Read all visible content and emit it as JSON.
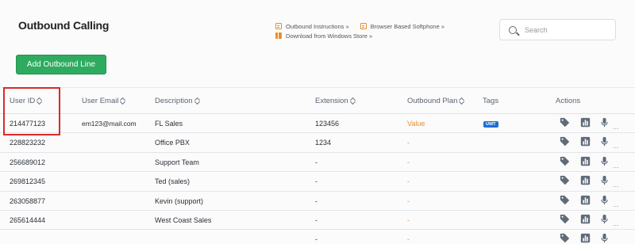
{
  "page": {
    "title": "Outbound Calling"
  },
  "links": {
    "outbound_instructions": "Outbound Instructions »",
    "browser_softphone": "Browser Based Softphone »",
    "windows_store": "Download from Windows Store »"
  },
  "search": {
    "placeholder": "Search"
  },
  "toolbar": {
    "add_label": "Add Outbound Line"
  },
  "table": {
    "headers": {
      "user_id": "User ID",
      "user_email": "User Email",
      "description": "Description",
      "extension": "Extension",
      "outbound_plan": "Outbound Plan",
      "tags": "Tags",
      "actions": "Actions"
    },
    "rows": [
      {
        "user_id": "214477123",
        "email": "em123@mail.com",
        "description": "FL Sales",
        "extension": "123456",
        "plan": "Value",
        "tag": "UWT"
      },
      {
        "user_id": "228823232",
        "email": "",
        "description": "Office PBX",
        "extension": "1234",
        "plan": "-",
        "tag": ""
      },
      {
        "user_id": "256689012",
        "email": "",
        "description": "Support Team",
        "extension": "-",
        "plan": "-",
        "tag": ""
      },
      {
        "user_id": "269812345",
        "email": "",
        "description": "Ted (sales)",
        "extension": "-",
        "plan": "-",
        "tag": ""
      },
      {
        "user_id": "263058877",
        "email": "",
        "description": "Kevin (support)",
        "extension": "-",
        "plan": "-",
        "tag": ""
      },
      {
        "user_id": "265614444",
        "email": "",
        "description": "West Coast Sales",
        "extension": "-",
        "plan": "-",
        "tag": ""
      },
      {
        "user_id": "",
        "email": "",
        "description": "",
        "extension": "-",
        "plan": "-",
        "tag": ""
      }
    ],
    "more_label": "..."
  },
  "colors": {
    "accent_green": "#2eab5f",
    "plan_orange": "#e8902b",
    "badge_blue": "#1f6fd1",
    "highlight_red": "#d92a2a",
    "action_icon": "#5f6b78"
  },
  "icons": {
    "search": "search-icon",
    "instructions": "document-icon",
    "softphone": "document-icon",
    "store": "windows-icon",
    "tag": "tag-icon",
    "stats": "bar-chart-icon",
    "mic": "microphone-icon"
  }
}
